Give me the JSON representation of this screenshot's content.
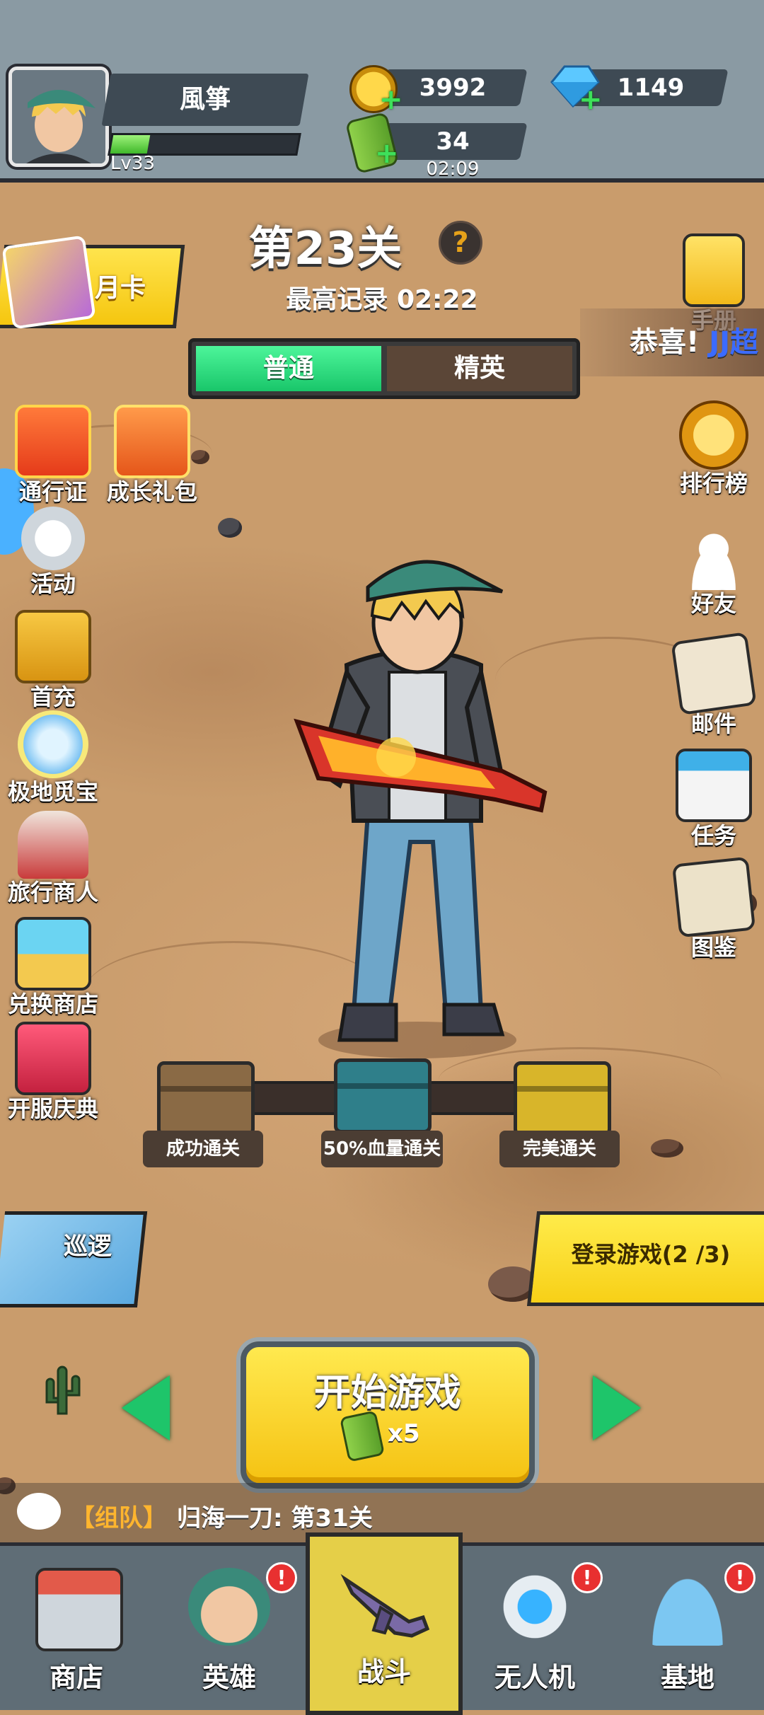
{
  "colors": {
    "accent_green": "#19c66a",
    "accent_yellow": "#f5c60f",
    "panel_dark": "#3e4a54",
    "badge_red": "#e83030"
  },
  "player": {
    "name": "風箏",
    "level": "Lv33",
    "xp_progress": 0.2,
    "avatar_icon": "hero-portrait-icon"
  },
  "resources": {
    "gold": "3992",
    "gems": "1149",
    "energy": "34",
    "energy_timer": "02:09",
    "gold_icon": "skull-coin-icon",
    "gem_icon": "diamond-icon",
    "energy_icon": "energy-can-icon"
  },
  "stage": {
    "title": "第23关",
    "best_record": "最高记录 02:22",
    "help": "?"
  },
  "modes": {
    "normal": "普通",
    "elite": "精英",
    "selected": "普通"
  },
  "month_card": {
    "label": "月卡"
  },
  "left_menu": [
    {
      "label": "通行证",
      "icon": "gift-box-icon"
    },
    {
      "label": "成长礼包",
      "icon": "gift-gems-icon"
    },
    {
      "label": "活动",
      "icon": "event-icon"
    },
    {
      "label": "首充",
      "icon": "treasure-chest-icon"
    },
    {
      "label": "极地觅宝",
      "icon": "ice-crystal-icon"
    },
    {
      "label": "旅行商人",
      "icon": "merchant-icon"
    },
    {
      "label": "兑换商店",
      "icon": "exchange-shop-icon"
    },
    {
      "label": "开服庆典",
      "icon": "celebration-icon"
    }
  ],
  "right_menu": [
    {
      "label": "手册",
      "icon": "manual-icon"
    },
    {
      "label": "排行榜",
      "icon": "leaderboard-icon"
    },
    {
      "label": "好友",
      "icon": "friends-icon"
    },
    {
      "label": "邮件",
      "icon": "mail-icon"
    },
    {
      "label": "任务",
      "icon": "task-icon"
    },
    {
      "label": "图鉴",
      "icon": "codex-icon"
    }
  ],
  "congrats": {
    "prefix": "恭喜!",
    "name": "JJ超"
  },
  "chests": [
    {
      "label": "成功通关",
      "color": "#8a6a45"
    },
    {
      "label": "50%血量通关",
      "color": "#2f7f8a"
    },
    {
      "label": "完美通关",
      "color": "#d8b52a"
    }
  ],
  "patrol": {
    "label": "巡逻"
  },
  "login_task": {
    "label": "登录游戏(2 /3)"
  },
  "start": {
    "label": "开始游戏",
    "cost": "x5"
  },
  "chat": {
    "tag": "【组队】",
    "message": "归海一刀: 第31关"
  },
  "nav": [
    {
      "label": "商店",
      "icon": "shop-icon",
      "badge": ""
    },
    {
      "label": "英雄",
      "icon": "hero-icon",
      "badge": "!"
    },
    {
      "label": "战斗",
      "icon": "rifle-icon",
      "badge": ""
    },
    {
      "label": "无人机",
      "icon": "drone-icon",
      "badge": "!"
    },
    {
      "label": "基地",
      "icon": "base-dome-icon",
      "badge": "!"
    }
  ]
}
